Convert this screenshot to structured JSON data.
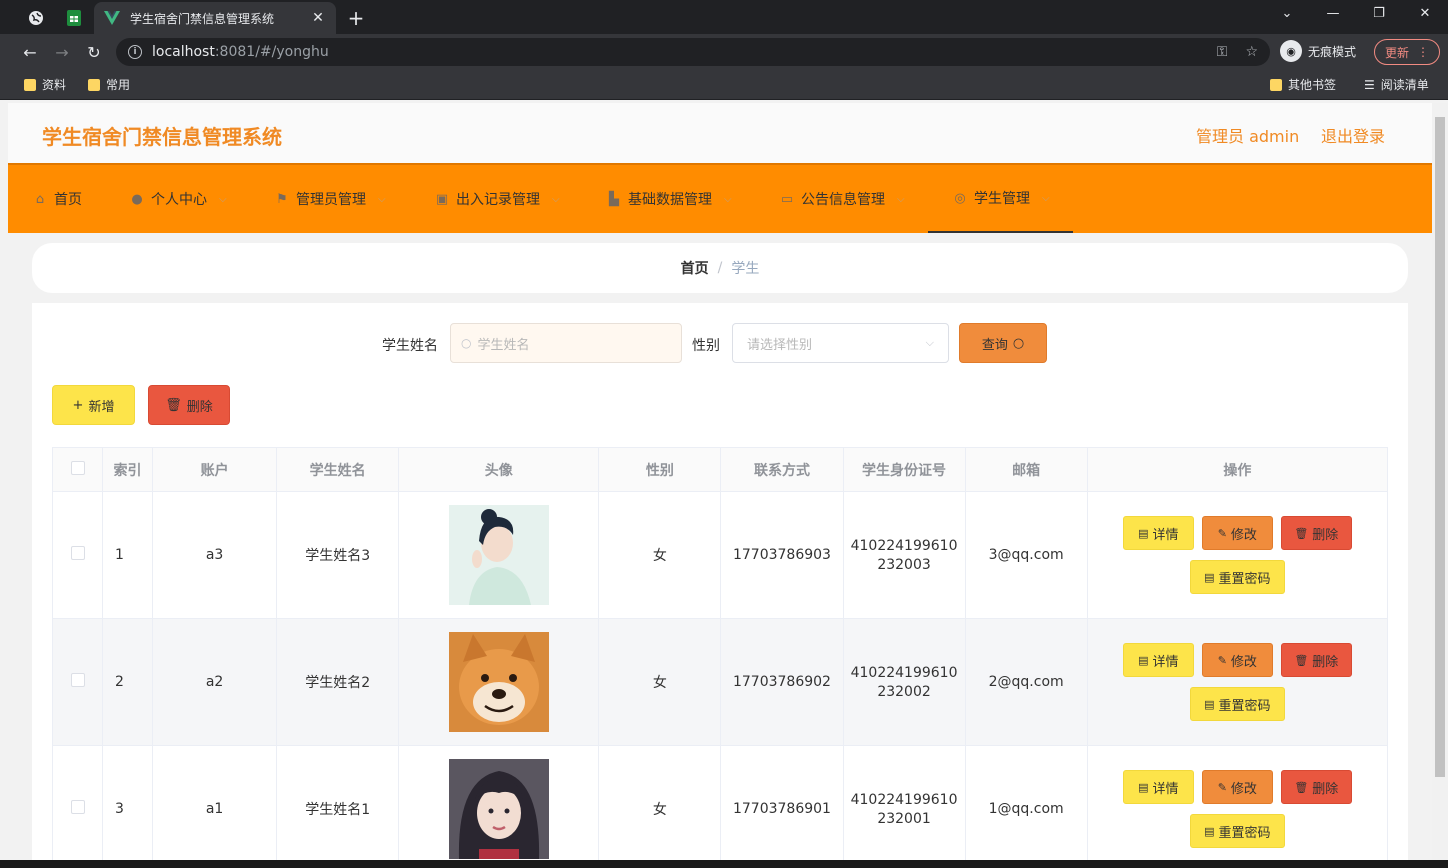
{
  "browser": {
    "tab_title": "学生宿舍门禁信息管理系统",
    "url_host": "localhost",
    "url_rest": ":8081/#/yonghu",
    "incognito_label": "无痕模式",
    "update_label": "更新",
    "bookmarks": [
      "资料",
      "常用"
    ],
    "bookmarks_right": [
      "其他书签",
      "阅读清单"
    ]
  },
  "header": {
    "title": "学生宿舍门禁信息管理系统",
    "admin_label": "管理员 admin",
    "logout_label": "退出登录"
  },
  "menu": [
    {
      "label": "首页",
      "icon": "home-icon"
    },
    {
      "label": "个人中心",
      "icon": "user-icon"
    },
    {
      "label": "管理员管理",
      "icon": "flag-icon"
    },
    {
      "label": "出入记录管理",
      "icon": "chip-icon"
    },
    {
      "label": "基础数据管理",
      "icon": "building-icon"
    },
    {
      "label": "公告信息管理",
      "icon": "message-icon"
    },
    {
      "label": "学生管理",
      "icon": "compass-icon"
    }
  ],
  "breadcrumb": {
    "home": "首页",
    "sep": "/",
    "current": "学生"
  },
  "search": {
    "name_label": "学生姓名",
    "name_placeholder": "学生姓名",
    "gender_label": "性别",
    "gender_placeholder": "请选择性别",
    "query_label": "查询"
  },
  "actions": {
    "add_label": "新增",
    "delete_label": "删除"
  },
  "table": {
    "headers": [
      "索引",
      "账户",
      "学生姓名",
      "头像",
      "性别",
      "联系方式",
      "学生身份证号",
      "邮箱",
      "操作"
    ],
    "rows": [
      {
        "index": "1",
        "account": "a3",
        "name": "学生姓名3",
        "gender": "女",
        "phone": "17703786903",
        "id_line1": "410224199610",
        "id_line2": "232003",
        "email": "3@qq.com"
      },
      {
        "index": "2",
        "account": "a2",
        "name": "学生姓名2",
        "gender": "女",
        "phone": "17703786902",
        "id_line1": "410224199610",
        "id_line2": "232002",
        "email": "2@qq.com"
      },
      {
        "index": "3",
        "account": "a1",
        "name": "学生姓名1",
        "gender": "女",
        "phone": "17703786901",
        "id_line1": "410224199610",
        "id_line2": "232001",
        "email": "1@qq.com"
      }
    ],
    "op_labels": {
      "detail": "详情",
      "edit": "修改",
      "delete": "删除",
      "reset": "重置密码"
    }
  },
  "colors": {
    "accent": "#ff8c00",
    "title": "#f08a24",
    "yellow_btn": "#fde44a",
    "orange_btn": "#f08c3c",
    "red_btn": "#e9573f"
  }
}
